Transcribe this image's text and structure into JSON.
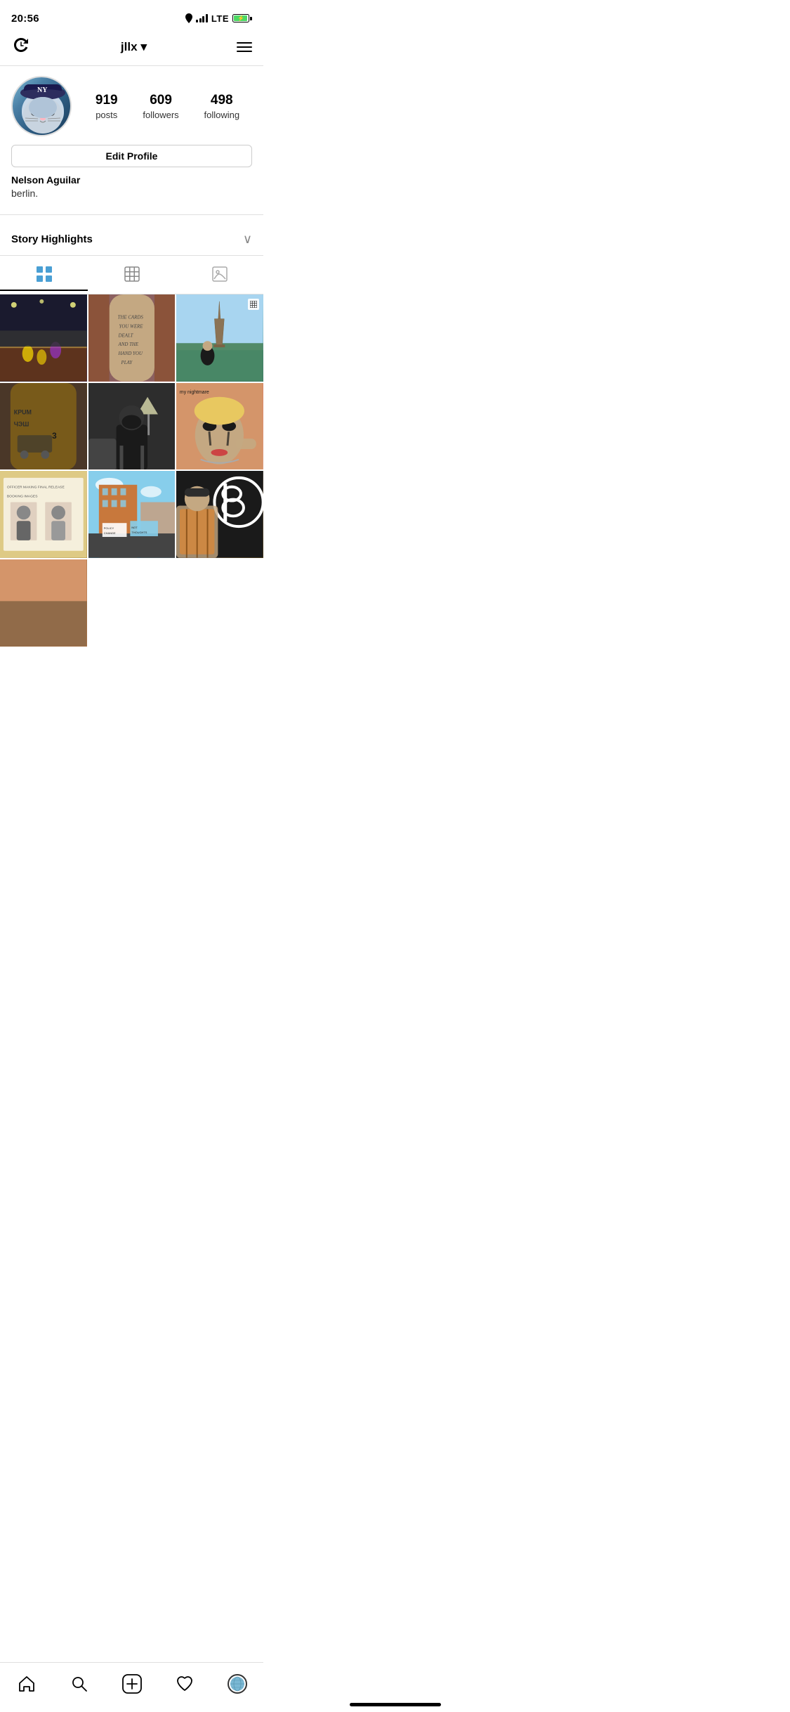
{
  "statusBar": {
    "time": "20:56",
    "lte": "LTE"
  },
  "nav": {
    "username": "jllx",
    "chevron": "▾",
    "menuIcon": "≡"
  },
  "profile": {
    "stats": {
      "posts": "919",
      "posts_label": "posts",
      "followers": "609",
      "followers_label": "followers",
      "following": "498",
      "following_label": "following"
    },
    "editButton": "Edit Profile",
    "name": "Nelson Aguilar",
    "bio": "berlin."
  },
  "storyHighlights": {
    "label": "Story Highlights"
  },
  "tabs": {
    "grid_label": "Grid",
    "reels_label": "Reels",
    "tagged_label": "Tagged"
  },
  "bottomNav": {
    "home": "home",
    "search": "search",
    "add": "add",
    "heart": "heart",
    "profile": "profile"
  }
}
